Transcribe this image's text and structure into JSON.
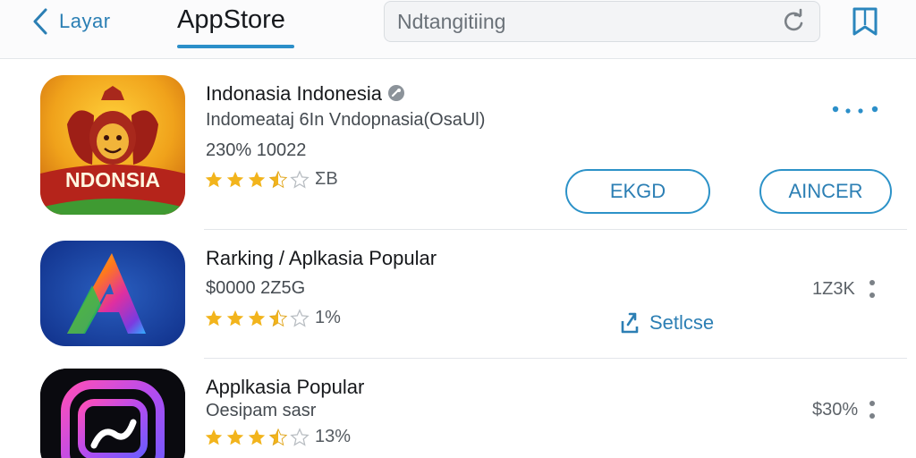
{
  "header": {
    "back_label": "Layar",
    "tab_title": "AppStore",
    "search_value": "Ndtangitiing"
  },
  "apps": [
    {
      "name": "Indonasia Indonesia",
      "subtitle": "Indomeataj 6In Vndopnasia(OsaUl)",
      "stats": "230% 10022",
      "rating": 3.5,
      "rating_text": "ΣΒ",
      "icon_text": "NDONSIA",
      "menu_icon": "more-horizontal-dots-icon",
      "buttons": [
        "EKGD",
        "AINCER"
      ]
    },
    {
      "name": "Rarking / Aplkasia Popular",
      "subtitle": "$0000 2Z5G",
      "rating": 3.5,
      "rating_text": "1%",
      "metric": "1Z3K",
      "share_label": "Setlcse"
    },
    {
      "name": "Applkasia Popular",
      "subtitle": "Oesipam sasr",
      "rating": 3.5,
      "rating_text": "13%",
      "metric": "$30%"
    }
  ],
  "colors": {
    "accent": "#2c8fc9",
    "star": "#f2b41c",
    "separator": "#e3e6ea"
  }
}
